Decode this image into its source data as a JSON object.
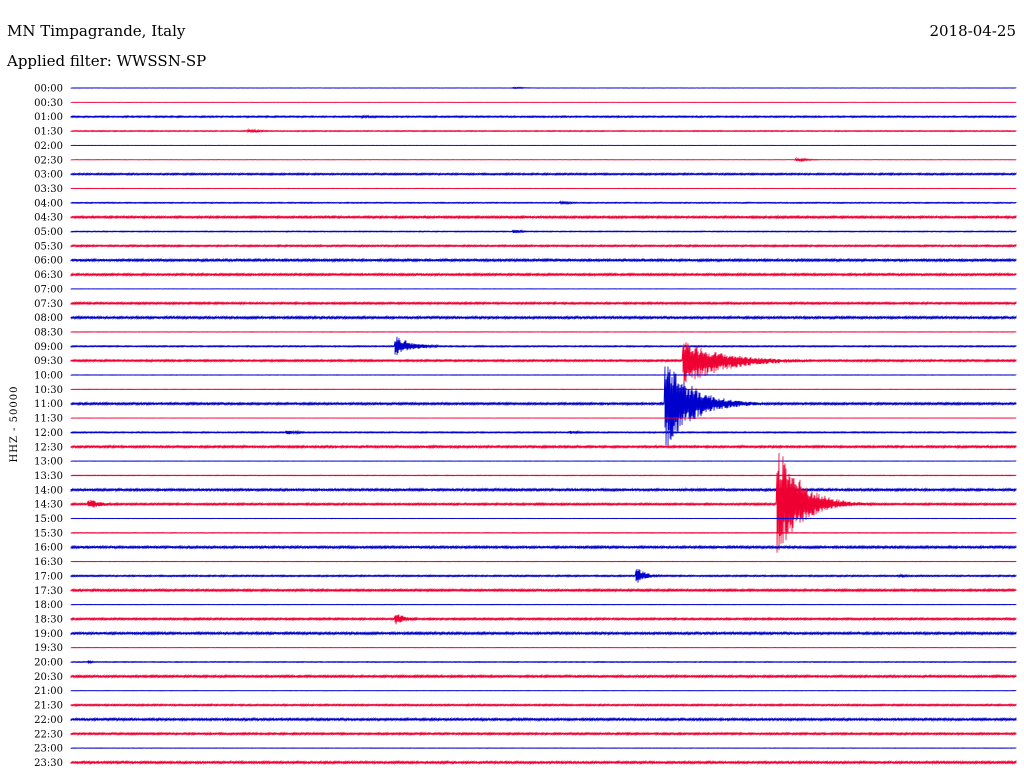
{
  "header": {
    "station": "MN Timpagrande, Italy",
    "date": "2018-04-25",
    "filter": "Applied filter: WWSSN-SP"
  },
  "chart_data": {
    "type": "line",
    "title": "MN Timpagrande, Italy",
    "subtitle": "Applied filter: WWSSN-SP",
    "date": "2018-04-25",
    "ylabel": "HHZ - 50000",
    "trace_colors": [
      "#0000cc",
      "#ee0033"
    ],
    "rows": [
      {
        "time": "00:00",
        "base_noise": 0.15,
        "events": [
          {
            "t": 0.47,
            "amp_up": 1.0,
            "amp_down": 0.5,
            "dur": 0.03
          }
        ]
      },
      {
        "time": "00:30",
        "base_noise": 0.1,
        "events": []
      },
      {
        "time": "01:00",
        "base_noise": 0.7,
        "events": [
          {
            "t": 0.31,
            "amp_up": 1.2,
            "amp_down": 1.2,
            "dur": 0.12
          }
        ]
      },
      {
        "time": "01:30",
        "base_noise": 0.45,
        "events": [
          {
            "t": 0.19,
            "amp_up": 1.5,
            "amp_down": 1.5,
            "dur": 0.05
          }
        ]
      },
      {
        "time": "02:00",
        "base_noise": 0.1,
        "events": []
      },
      {
        "time": "02:30",
        "base_noise": 0.12,
        "events": [
          {
            "t": 0.77,
            "amp_up": 1.6,
            "amp_down": 1.6,
            "dur": 0.03
          }
        ]
      },
      {
        "time": "03:00",
        "base_noise": 0.8,
        "events": []
      },
      {
        "time": "03:30",
        "base_noise": 0.15,
        "events": []
      },
      {
        "time": "04:00",
        "base_noise": 0.5,
        "events": [
          {
            "t": 0.52,
            "amp_up": 1.3,
            "amp_down": 1.3,
            "dur": 0.05
          }
        ]
      },
      {
        "time": "04:30",
        "base_noise": 1.0,
        "events": []
      },
      {
        "time": "05:00",
        "base_noise": 0.45,
        "events": [
          {
            "t": 0.47,
            "amp_up": 1.8,
            "amp_down": 1.8,
            "dur": 0.03
          }
        ]
      },
      {
        "time": "05:30",
        "base_noise": 0.8,
        "events": []
      },
      {
        "time": "06:00",
        "base_noise": 1.1,
        "events": []
      },
      {
        "time": "06:30",
        "base_noise": 1.0,
        "events": []
      },
      {
        "time": "07:00",
        "base_noise": 0.15,
        "events": []
      },
      {
        "time": "07:30",
        "base_noise": 0.9,
        "events": []
      },
      {
        "time": "08:00",
        "base_noise": 1.1,
        "events": []
      },
      {
        "time": "08:30",
        "base_noise": 0.2,
        "events": []
      },
      {
        "time": "09:00",
        "base_noise": 0.6,
        "events": [
          {
            "t": 0.345,
            "amp_up": 10,
            "amp_down": 9,
            "dur": 0.05
          }
        ]
      },
      {
        "time": "09:30",
        "base_noise": 0.9,
        "events": [
          {
            "t": 0.65,
            "amp_up": 19,
            "amp_down": 26,
            "dur": 0.12
          }
        ]
      },
      {
        "time": "10:00",
        "base_noise": 0.2,
        "events": []
      },
      {
        "time": "10:30",
        "base_noise": 0.2,
        "events": []
      },
      {
        "time": "11:00",
        "base_noise": 1.0,
        "events": [
          {
            "t": 0.631,
            "amp_up": 46,
            "amp_down": 46,
            "dur": 0.08
          }
        ]
      },
      {
        "time": "11:30",
        "base_noise": 0.1,
        "events": []
      },
      {
        "time": "12:00",
        "base_noise": 0.6,
        "events": [
          {
            "t": 0.23,
            "amp_up": 2.2,
            "amp_down": 2.2,
            "dur": 0.04
          },
          {
            "t": 0.53,
            "amp_up": 1.5,
            "amp_down": 1.5,
            "dur": 0.04
          }
        ]
      },
      {
        "time": "12:30",
        "base_noise": 1.0,
        "events": []
      },
      {
        "time": "13:00",
        "base_noise": 0.15,
        "events": []
      },
      {
        "time": "13:30",
        "base_noise": 0.3,
        "events": []
      },
      {
        "time": "14:00",
        "base_noise": 1.1,
        "events": []
      },
      {
        "time": "14:30",
        "base_noise": 0.9,
        "events": [
          {
            "t": 0.02,
            "amp_up": 5,
            "amp_down": 5,
            "dur": 0.04
          },
          {
            "t": 0.75,
            "amp_up": 60,
            "amp_down": 50,
            "dur": 0.07
          }
        ]
      },
      {
        "time": "15:00",
        "base_noise": 0.15,
        "events": []
      },
      {
        "time": "15:30",
        "base_noise": 0.3,
        "events": []
      },
      {
        "time": "16:00",
        "base_noise": 1.1,
        "events": []
      },
      {
        "time": "16:30",
        "base_noise": 0.2,
        "events": []
      },
      {
        "time": "17:00",
        "base_noise": 0.7,
        "events": [
          {
            "t": 0.6,
            "amp_up": 8,
            "amp_down": 7,
            "dur": 0.03
          },
          {
            "t": 0.88,
            "amp_up": 1.5,
            "amp_down": 1.5,
            "dur": 0.03
          }
        ]
      },
      {
        "time": "17:30",
        "base_noise": 1.0,
        "events": []
      },
      {
        "time": "18:00",
        "base_noise": 0.2,
        "events": []
      },
      {
        "time": "18:30",
        "base_noise": 0.9,
        "events": [
          {
            "t": 0.345,
            "amp_up": 6,
            "amp_down": 6,
            "dur": 0.03
          }
        ]
      },
      {
        "time": "19:00",
        "base_noise": 1.1,
        "events": []
      },
      {
        "time": "19:30",
        "base_noise": 0.15,
        "events": []
      },
      {
        "time": "20:00",
        "base_noise": 0.4,
        "events": [
          {
            "t": 0.02,
            "amp_up": 1.5,
            "amp_down": 1.5,
            "dur": 0.01
          }
        ]
      },
      {
        "time": "20:30",
        "base_noise": 1.0,
        "events": []
      },
      {
        "time": "21:00",
        "base_noise": 0.15,
        "events": []
      },
      {
        "time": "21:30",
        "base_noise": 0.8,
        "events": []
      },
      {
        "time": "22:00",
        "base_noise": 1.1,
        "events": []
      },
      {
        "time": "22:30",
        "base_noise": 0.9,
        "events": []
      },
      {
        "time": "23:00",
        "base_noise": 0.2,
        "events": []
      },
      {
        "time": "23:30",
        "base_noise": 1.1,
        "events": []
      }
    ]
  }
}
